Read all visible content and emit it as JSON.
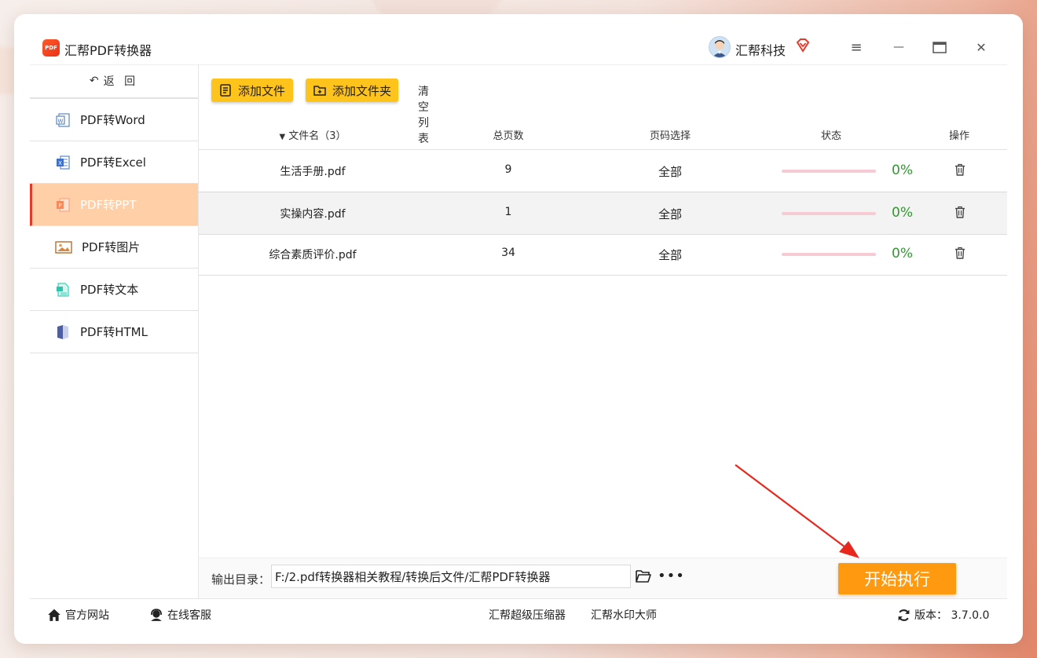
{
  "app": {
    "title": "汇帮PDF转换器",
    "logo_text": "PDF",
    "user_name": "汇帮科技"
  },
  "window_controls": {
    "menu": "≡",
    "minimize": "—",
    "maximize": "☐",
    "close": "✕"
  },
  "sidebar": {
    "back_label": "返 回",
    "items": [
      {
        "label": "PDF转Word",
        "icon": "word-icon",
        "active": false
      },
      {
        "label": "PDF转Excel",
        "icon": "excel-icon",
        "active": false
      },
      {
        "label": "PDF转PPT",
        "icon": "ppt-icon",
        "active": true
      },
      {
        "label": "PDF转图片",
        "icon": "image-icon",
        "active": false
      },
      {
        "label": "PDF转文本",
        "icon": "text-icon",
        "active": false
      },
      {
        "label": "PDF转HTML",
        "icon": "html-icon",
        "active": false
      }
    ]
  },
  "toolbar": {
    "add_file": "添加文件",
    "add_folder": "添加文件夹",
    "clear_list": "清空列表"
  },
  "table": {
    "headers": {
      "filename": "文件名（3）",
      "pages": "总页数",
      "page_select": "页码选择",
      "status": "状态",
      "action": "操作"
    },
    "rows": [
      {
        "filename": "生活手册.pdf",
        "pages": "9",
        "page_select": "全部",
        "progress_text": "0%",
        "progress": 0
      },
      {
        "filename": "实操内容.pdf",
        "pages": "1",
        "page_select": "全部",
        "progress_text": "0%",
        "progress": 0
      },
      {
        "filename": "综合素质评价.pdf",
        "pages": "34",
        "page_select": "全部",
        "progress_text": "0%",
        "progress": 0
      }
    ]
  },
  "output": {
    "label": "输出目录：",
    "path": "F:/2.pdf转换器相关教程/转换后文件/汇帮PDF转换器",
    "more": "•••"
  },
  "start_button": "开始执行",
  "footer": {
    "website": "官方网站",
    "support": "在线客服",
    "compressor": "汇帮超级压缩器",
    "watermark": "汇帮水印大师",
    "version": "版本：  3.7.0.0"
  },
  "colors": {
    "accent": "#ffc41c",
    "active_nav": "#ffcfa8",
    "start": "#ff9a10",
    "progress_text": "#2e9a2e",
    "progress_track": "#f7cbd3",
    "arrow": "#e8281e"
  }
}
